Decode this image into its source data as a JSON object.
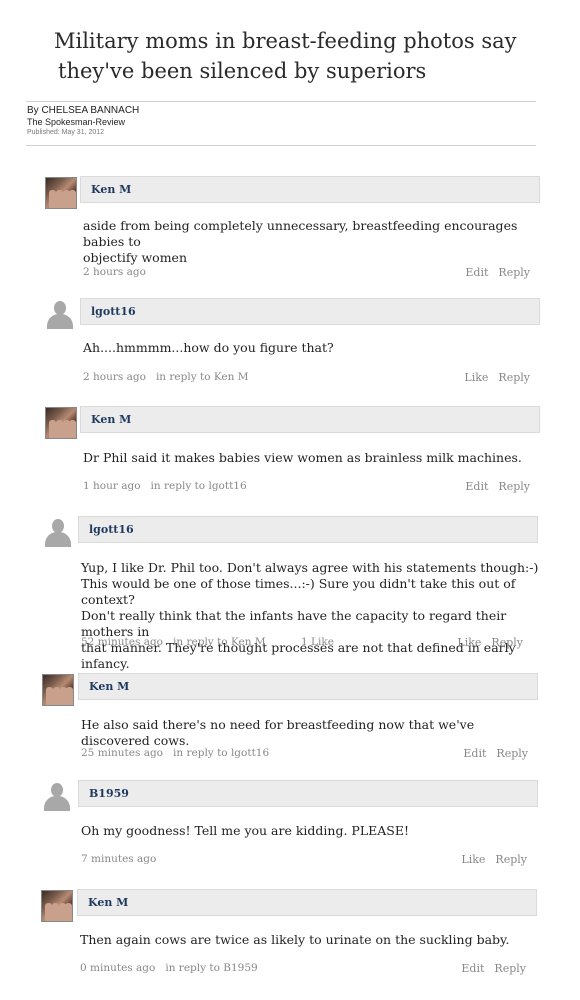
{
  "article": {
    "headline_line1": "Military moms in breast-feeding photos say",
    "headline_line2": "they've been silenced by superiors",
    "author": "By CHELSEA BANNACH",
    "source": "The Spokesman-Review",
    "published": "Published: May 31, 2012"
  },
  "comments": [
    {
      "author": "Ken M",
      "avatar": "user-photo",
      "body": [
        "aside from being completely unnecessary, breastfeeding encourages babies to",
        "objectify women"
      ],
      "time": "2 hours ago",
      "reply_to": "",
      "likes": "",
      "action1": "Edit",
      "action2": "Reply"
    },
    {
      "author": "lgott16",
      "avatar": "default-user",
      "body": [
        "Ah....hmmmm...how do you figure that?"
      ],
      "time": "2 hours ago",
      "reply_to": "in reply to Ken M",
      "likes": "",
      "action1": "Like",
      "action2": "Reply"
    },
    {
      "author": "Ken M",
      "avatar": "user-photo",
      "body": [
        "Dr Phil said it makes babies view women as brainless milk machines."
      ],
      "time": "1 hour ago",
      "reply_to": "in reply to lgott16",
      "likes": "",
      "action1": "Edit",
      "action2": "Reply"
    },
    {
      "author": "lgott16",
      "avatar": "default-user",
      "body": [
        "Yup, I like Dr. Phil too. Don't always agree with his statements though:-)",
        "This would be one of those times...:-) Sure you didn't take this out of context?",
        "Don't really think that the infants have the capacity to regard their mothers in",
        "that manner.  They're thought processes are not that defined in early infancy."
      ],
      "time": "52 minutes ago",
      "reply_to": "in reply to Ken M",
      "likes": "1 Like",
      "action1": "Like",
      "action2": "Reply"
    },
    {
      "author": "Ken M",
      "avatar": "user-photo",
      "body": [
        "He also said there's no need for breastfeeding now that we've discovered cows."
      ],
      "time": "25 minutes ago",
      "reply_to": "in reply to lgott16",
      "likes": "",
      "action1": "Edit",
      "action2": "Reply"
    },
    {
      "author": "B1959",
      "avatar": "default-user",
      "body": [
        "Oh my goodness!  Tell me you are kidding.  PLEASE!"
      ],
      "time": "7 minutes ago",
      "reply_to": "",
      "likes": "",
      "action1": "Like",
      "action2": "Reply"
    },
    {
      "author": "Ken M",
      "avatar": "user-photo",
      "body": [
        "Then again cows are twice as likely to urinate on the suckling baby."
      ],
      "time": "0 minutes ago",
      "reply_to": "in reply to B1959",
      "likes": "",
      "action1": "Edit",
      "action2": "Reply"
    }
  ]
}
